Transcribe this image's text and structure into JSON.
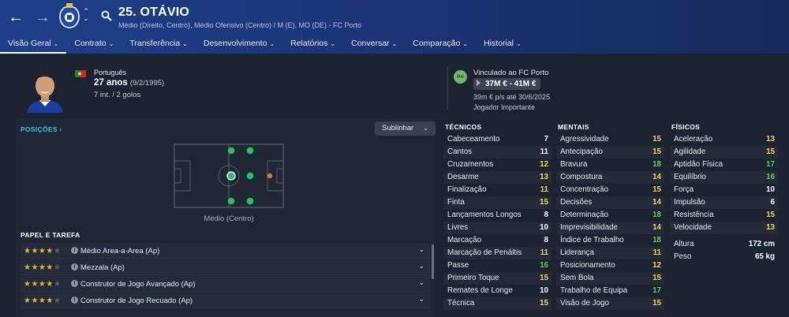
{
  "header": {
    "title": "25. OTÁVIO",
    "subtitle": "Médio (Direito, Centro), Médio Ofensivo (Centro) / M (E), MO (DE) - FC Porto",
    "tabs": [
      {
        "label": "Visão Geral"
      },
      {
        "label": "Contrato"
      },
      {
        "label": "Transferência"
      },
      {
        "label": "Desenvolvimento"
      },
      {
        "label": "Relatórios"
      },
      {
        "label": "Conversar"
      },
      {
        "label": "Comparação"
      },
      {
        "label": "Historial"
      }
    ],
    "icons": {
      "back": "arrow-left-icon",
      "forward": "arrow-right-icon",
      "crest": "fc-porto-crest-icon",
      "search": "search-icon"
    }
  },
  "profile": {
    "nationality": "Português",
    "age": "27 anos",
    "dob": "(9/2/1995)",
    "caps": "7 int. / 2 golos",
    "contract_label": "Vinculado ao FC Porto",
    "club_badge": "Pri",
    "value_range": "37M € - 41M €",
    "wage": "39m € p/s até 30/6/2025",
    "importance": "Jogador Importante"
  },
  "positions": {
    "title": "POSIÇÕES",
    "highlight_label": "Sublinhar",
    "current_position": "Médio (Centro)"
  },
  "roles": {
    "title": "PAPEL E TAREFA",
    "items": [
      {
        "name": "Médio Area-a-Area (Ap)",
        "stars": 4
      },
      {
        "name": "Mezzala (Ap)",
        "stars": 4
      },
      {
        "name": "Construtor de Jogo Avançado (Ap)",
        "stars": 4
      },
      {
        "name": "Construtor de Jogo Recuado (Ap)",
        "stars": 4
      }
    ]
  },
  "attributes": {
    "technical": {
      "title": "TÉCNICOS",
      "items": [
        {
          "name": "Cabeceamento",
          "value": "7",
          "color": "#ffffff"
        },
        {
          "name": "Cantos",
          "value": "11",
          "color": "#ffffff"
        },
        {
          "name": "Cruzamentos",
          "value": "12",
          "color": "#f2d94b"
        },
        {
          "name": "Desarme",
          "value": "13",
          "color": "#f2d94b"
        },
        {
          "name": "Finalização",
          "value": "11",
          "color": "#f2d94b"
        },
        {
          "name": "Finta",
          "value": "15",
          "color": "#f2d94b"
        },
        {
          "name": "Lançamentos Longos",
          "value": "8",
          "color": "#ffffff"
        },
        {
          "name": "Livres",
          "value": "10",
          "color": "#ffffff"
        },
        {
          "name": "Marcação",
          "value": "8",
          "color": "#ffffff"
        },
        {
          "name": "Marcação de Penáltis",
          "value": "11",
          "color": "#f2d94b"
        },
        {
          "name": "Passe",
          "value": "16",
          "color": "#57d24e"
        },
        {
          "name": "Primeiro Toque",
          "value": "15",
          "color": "#f2d94b"
        },
        {
          "name": "Remates de Longe",
          "value": "10",
          "color": "#ffffff"
        },
        {
          "name": "Técnica",
          "value": "15",
          "color": "#f2d94b"
        }
      ]
    },
    "mental": {
      "title": "MENTAIS",
      "items": [
        {
          "name": "Agressividade",
          "value": "15",
          "color": "#f2d94b"
        },
        {
          "name": "Antecipação",
          "value": "15",
          "color": "#f2d94b"
        },
        {
          "name": "Bravura",
          "value": "18",
          "color": "#57d24e"
        },
        {
          "name": "Compostura",
          "value": "14",
          "color": "#f2d94b"
        },
        {
          "name": "Concentração",
          "value": "15",
          "color": "#f2d94b"
        },
        {
          "name": "Decisões",
          "value": "14",
          "color": "#f2d94b"
        },
        {
          "name": "Determinação",
          "value": "18",
          "color": "#57d24e"
        },
        {
          "name": "Imprevisibilidade",
          "value": "14",
          "color": "#f2d94b"
        },
        {
          "name": "Índice de Trabalho",
          "value": "18",
          "color": "#57d24e"
        },
        {
          "name": "Liderança",
          "value": "11",
          "color": "#f2d94b"
        },
        {
          "name": "Posicionamento",
          "value": "12",
          "color": "#f2d94b"
        },
        {
          "name": "Sem Bola",
          "value": "15",
          "color": "#f2d94b"
        },
        {
          "name": "Trabalho de Equipa",
          "value": "17",
          "color": "#57d24e"
        },
        {
          "name": "Visão de Jogo",
          "value": "15",
          "color": "#f2d94b"
        }
      ]
    },
    "physical": {
      "title": "FÍSICOS",
      "items": [
        {
          "name": "Aceleração",
          "value": "13",
          "color": "#f2d94b"
        },
        {
          "name": "Agilidade",
          "value": "15",
          "color": "#f2d94b"
        },
        {
          "name": "Aptidão Física",
          "value": "17",
          "color": "#57d24e"
        },
        {
          "name": "Equilíbrio",
          "value": "16",
          "color": "#57d24e"
        },
        {
          "name": "Força",
          "value": "10",
          "color": "#ffffff"
        },
        {
          "name": "Impulsão",
          "value": "6",
          "color": "#ffffff"
        },
        {
          "name": "Resistência",
          "value": "15",
          "color": "#f2d94b"
        },
        {
          "name": "Velocidade",
          "value": "13",
          "color": "#f2d94b"
        }
      ],
      "extra": [
        {
          "name": "Altura",
          "value": "172 cm"
        },
        {
          "name": "Peso",
          "value": "65 kg"
        }
      ]
    }
  }
}
